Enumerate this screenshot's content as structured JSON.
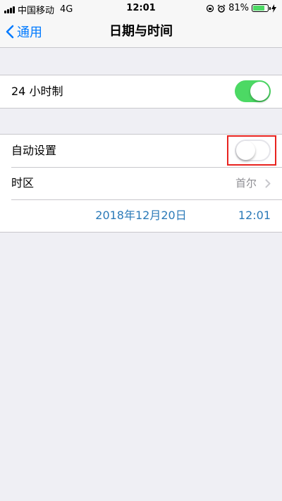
{
  "status_bar": {
    "carrier": "中国移动",
    "network": "4G",
    "time": "12:01",
    "battery": "81%",
    "battery_level": 0.81
  },
  "nav": {
    "back_label": "通用",
    "title": "日期与时间"
  },
  "settings": {
    "hour24": {
      "label": "24 小时制",
      "enabled": true
    },
    "auto_set": {
      "label": "自动设置",
      "enabled": false
    },
    "timezone": {
      "label": "时区",
      "value": "首尔"
    },
    "date": "2018年12月20日",
    "time": "12:01"
  },
  "colors": {
    "accent": "#007aff",
    "toggle_on": "#4cd964",
    "date_text": "#2b7ab8",
    "highlight": "#e8231f"
  }
}
